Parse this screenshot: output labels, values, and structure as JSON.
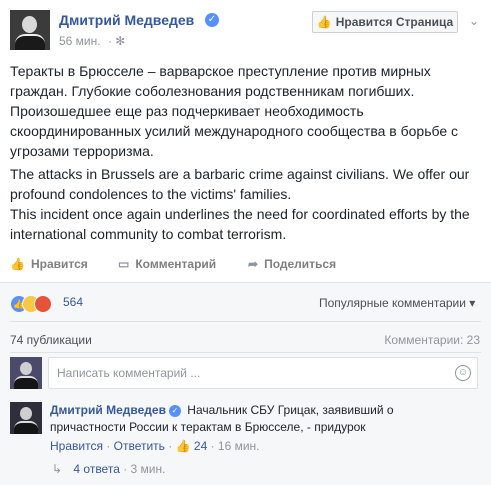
{
  "post": {
    "author": "Дмитрий Медведев",
    "time": "56 мин.",
    "like_page_label": "Нравится Страница",
    "text_ru": "Теракты в Брюсселе – варварское преступление против мирных граждан. Глубокие соболезнования родственникам погибших. Произошедшее еще раз подчеркивает необходимость скоординированных усилий международного сообщества в борьбе с угрозами терроризма.",
    "text_en_1": "The attacks in Brussels are a barbaric crime against civilians. We offer our profound condolences to the victims' families.",
    "text_en_2": "This incident once again underlines the need for coordinated efforts by the international community to combat terrorism."
  },
  "actions": {
    "like": "Нравится",
    "comment": "Комментарий",
    "share": "Поделиться"
  },
  "reactions": {
    "count": "564",
    "sort_label": "Популярные комментарии"
  },
  "stats": {
    "publications": "74 публикации",
    "comments": "Комментарии: 23"
  },
  "composer": {
    "placeholder": "Написать комментарий ..."
  },
  "comment": {
    "author": "Дмитрий Медведев",
    "text": "Начальник СБУ Грицак, заявивший о причастности России к терактам в Брюсселе, - придурок",
    "like": "Нравится",
    "reply": "Ответить",
    "likes": "24",
    "time": "16 мин.",
    "replies": "4 ответа",
    "replies_time": "3 мин."
  },
  "colors": {
    "link": "#365899",
    "verified": "#5890ff",
    "ufi_background": "#f6f7f9"
  },
  "icons": [
    "verified-icon",
    "globe-icon",
    "thumbs-up-icon",
    "comment-icon",
    "share-icon",
    "smile-icon",
    "reply-arrow-icon",
    "chevron-down-icon"
  ]
}
